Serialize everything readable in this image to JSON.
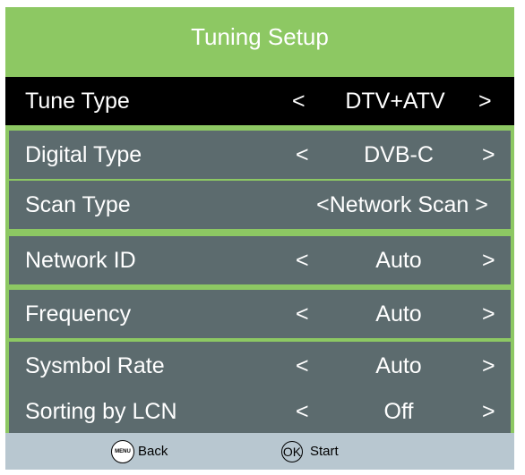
{
  "title": "Tuning Setup",
  "rows": [
    {
      "label": "Tune Type",
      "left": "<",
      "value": "DTV+ATV",
      "right": ">"
    },
    {
      "label": "Digital Type",
      "left": "<",
      "value": "DVB-C",
      "right": ">"
    },
    {
      "label": "Scan Type",
      "value": "<Network Scan >"
    },
    {
      "label": "Network ID",
      "left": "<",
      "value": "Auto",
      "right": ">"
    },
    {
      "label": "Frequency",
      "left": "<",
      "value": "Auto",
      "right": ">"
    },
    {
      "label": "Sysmbol Rate",
      "left": "<",
      "value": "Auto",
      "right": ">"
    },
    {
      "label": "Sorting by LCN",
      "left": "<",
      "value": "Off",
      "right": ">"
    }
  ],
  "footer": {
    "menu_icon_text": "MENU",
    "back_label": "Back",
    "ok_icon_text": "OK",
    "start_label": "Start"
  },
  "colors": {
    "header_green": "#8dc863",
    "row_gray": "#5c6b6e",
    "selected_row": "#000000",
    "footer_blue_gray": "#b8c7d0"
  }
}
